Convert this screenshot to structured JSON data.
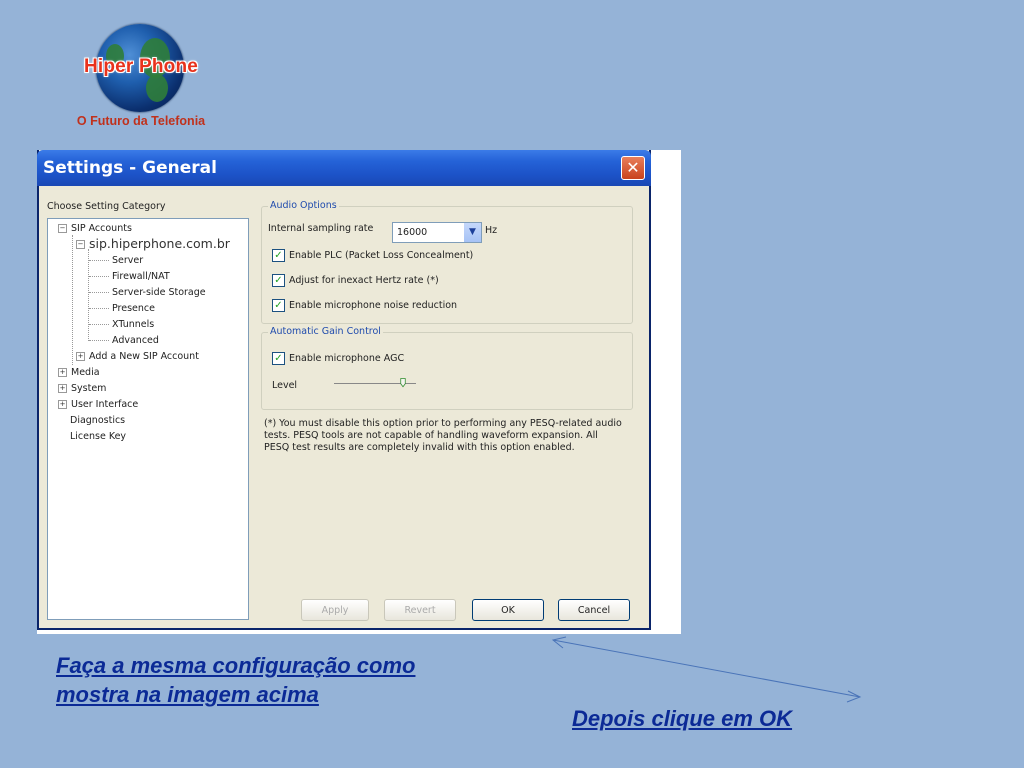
{
  "logo": {
    "brand": "Hiper Phone",
    "tagline": "O Futuro da Telefonia"
  },
  "dialog": {
    "title": "Settings - General",
    "close_label": "✕",
    "category_label": "Choose Setting Category",
    "tree": {
      "sip_accounts": "SIP Accounts",
      "account": "sip.hiperphone.com.br",
      "server": "Server",
      "firewall": "Firewall/NAT",
      "storage": "Server-side Storage",
      "presence": "Presence",
      "xtunnels": "XTunnels",
      "advanced": "Advanced",
      "add_account": "Add a New SIP Account",
      "media": "Media",
      "system": "System",
      "user_interface": "User Interface",
      "diagnostics": "Diagnostics",
      "license": "License Key",
      "expand_minus": "−",
      "expand_plus": "+"
    },
    "audio": {
      "group_label": "Audio Options",
      "sampling_label": "Internal sampling rate",
      "sampling_value": "16000",
      "sampling_unit": "Hz",
      "plc_label": "Enable PLC (Packet Loss Concealment)",
      "plc_checked": true,
      "hertz_label": "Adjust for inexact Hertz rate (*)",
      "hertz_checked": true,
      "noise_label": "Enable microphone noise reduction",
      "noise_checked": true
    },
    "agc": {
      "group_label": "Automatic Gain Control",
      "agc_label": "Enable microphone AGC",
      "agc_checked": true,
      "level_label": "Level",
      "level_fraction": 0.85
    },
    "note": "(*) You must disable this option prior to performing any PESQ-related audio tests.  PESQ tools are not capable of handling waveform expansion. All PESQ test results are completely invalid with this option enabled.",
    "buttons": {
      "apply": "Apply",
      "revert": "Revert",
      "ok": "OK",
      "cancel": "Cancel"
    }
  },
  "captions": {
    "instruction_line1": "Faça a mesma configuração como",
    "instruction_line2": "mostra na imagem acima",
    "click_ok": "Depois clique em OK"
  },
  "colors": {
    "background": "#95b3d7",
    "caption": "#0b2a96",
    "titlebar": "#2563d8",
    "brand": "#e8321c"
  }
}
